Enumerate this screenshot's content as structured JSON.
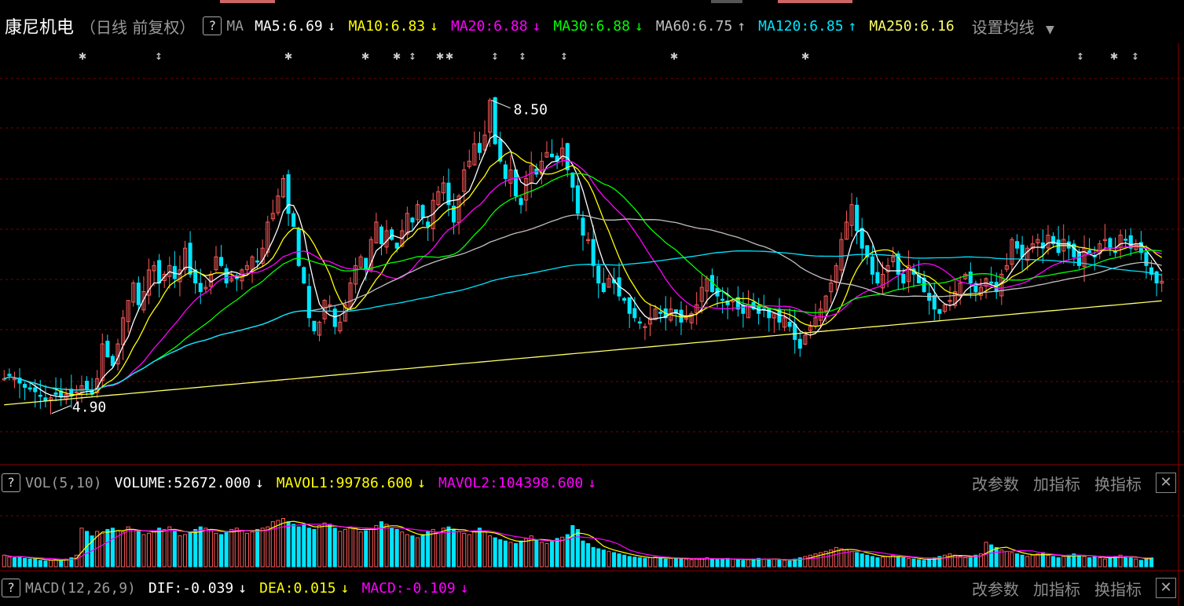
{
  "header": {
    "help_icon": "?",
    "stock_name": "康尼机电",
    "period": "（日线 前复权）",
    "ma_label": "MA",
    "indicators": [
      {
        "label": "MA5:6.69",
        "arrow": "↓",
        "color": "#ffffff"
      },
      {
        "label": "MA10:6.83",
        "arrow": "↓",
        "color": "#ffff00"
      },
      {
        "label": "MA20:6.88",
        "arrow": "↓",
        "color": "#ff00ff"
      },
      {
        "label": "MA30:6.88",
        "arrow": "↓",
        "color": "#00ff00"
      },
      {
        "label": "MA60:6.75",
        "arrow": "↑",
        "color": "#c0c0c0"
      },
      {
        "label": "MA120:6.85",
        "arrow": "↑",
        "color": "#00e5ff"
      },
      {
        "label": "MA250:6.16",
        "arrow": "",
        "color": "#ffff66"
      }
    ],
    "settings_label": "设置均线",
    "settings_icon": "chevron-down-icon"
  },
  "annotations": {
    "high": "8.50",
    "low": "4.90"
  },
  "vol_panel": {
    "help_icon": "?",
    "name": "VOL(5,10)",
    "items": [
      {
        "label": "VOLUME:52672.000",
        "arrow": "↓",
        "color": "#ffffff"
      },
      {
        "label": "MAVOL1:99786.600",
        "arrow": "↓",
        "color": "#ffff00"
      },
      {
        "label": "MAVOL2:104398.600",
        "arrow": "↓",
        "color": "#ff00ff"
      }
    ],
    "tools": [
      "改参数",
      "加指标",
      "换指标"
    ],
    "close": "✕"
  },
  "macd_panel": {
    "help_icon": "?",
    "name": "MACD(12,26,9)",
    "items": [
      {
        "label": "DIF:-0.039",
        "arrow": "↓",
        "color": "#ffffff"
      },
      {
        "label": "DEA:0.015",
        "arrow": "↓",
        "color": "#ffff00"
      },
      {
        "label": "MACD:-0.109",
        "arrow": "↓",
        "color": "#ff00ff"
      }
    ],
    "tools": [
      "改参数",
      "加指标",
      "换指标"
    ],
    "close": "✕"
  },
  "colors": {
    "up": "#ff5a5a",
    "down": "#00e5ff",
    "grid": "#7a0000"
  },
  "chart_data": {
    "type": "candlestick",
    "ylim": [
      4.6,
      8.75
    ],
    "high": 8.5,
    "low": 4.9,
    "marker_count": 18,
    "close_prices": [
      5.3,
      5.34,
      5.3,
      5.25,
      5.2,
      5.18,
      5.15,
      5.1,
      5.05,
      5.08,
      5.12,
      5.1,
      5.12,
      5.1,
      5.15,
      5.22,
      5.18,
      5.12,
      5.3,
      5.7,
      5.55,
      5.45,
      5.7,
      6.0,
      6.2,
      6.4,
      6.15,
      6.3,
      6.55,
      6.6,
      6.4,
      6.5,
      6.6,
      6.45,
      6.55,
      6.8,
      6.5,
      6.4,
      6.3,
      6.35,
      6.5,
      6.7,
      6.6,
      6.4,
      6.45,
      6.45,
      6.55,
      6.6,
      6.7,
      6.65,
      6.8,
      7.1,
      7.2,
      7.4,
      7.6,
      7.2,
      7.05,
      6.6,
      6.4,
      6.0,
      5.85,
      5.95,
      6.2,
      6.15,
      5.9,
      5.95,
      6.15,
      6.4,
      6.6,
      6.7,
      6.55,
      6.9,
      7.1,
      6.85,
      7.0,
      6.9,
      6.8,
      7.0,
      7.2,
      7.1,
      7.3,
      7.15,
      7.05,
      7.35,
      7.45,
      7.55,
      7.3,
      7.1,
      7.4,
      7.7,
      7.8,
      8.0,
      7.9,
      8.1,
      8.5,
      8.0,
      7.8,
      7.6,
      7.7,
      7.4,
      7.3,
      7.6,
      7.75,
      7.65,
      7.8,
      7.9,
      7.85,
      7.8,
      7.95,
      7.7,
      7.5,
      7.2,
      6.95,
      6.9,
      6.6,
      6.4,
      6.3,
      6.45,
      6.4,
      6.25,
      6.2,
      6.05,
      6.0,
      5.95,
      5.9,
      6.0,
      6.1,
      6.05,
      6.0,
      6.1,
      6.05,
      5.95,
      6.0,
      6.05,
      6.15,
      6.35,
      6.45,
      6.3,
      6.25,
      6.2,
      6.15,
      6.2,
      6.1,
      6.05,
      6.15,
      6.1,
      6.05,
      6.1,
      6.0,
      6.05,
      5.95,
      6.0,
      5.9,
      5.75,
      5.65,
      5.8,
      5.9,
      6.0,
      6.1,
      6.25,
      6.4,
      6.6,
      6.9,
      7.1,
      7.3,
      7.0,
      6.8,
      6.7,
      6.5,
      6.4,
      6.5,
      6.6,
      6.7,
      6.5,
      6.4,
      6.6,
      6.5,
      6.4,
      6.3,
      6.2,
      6.1,
      6.05,
      6.15,
      6.2,
      6.3,
      6.4,
      6.5,
      6.4,
      6.3,
      6.35,
      6.45,
      6.4,
      6.3,
      6.5,
      6.6,
      6.9,
      6.8,
      6.7,
      6.8,
      6.85,
      6.9,
      6.8,
      6.95,
      6.85,
      6.75,
      6.9,
      6.8,
      6.7,
      6.6,
      6.8,
      6.75,
      6.7,
      6.85,
      6.9,
      6.8,
      6.75,
      6.95,
      6.9,
      6.8,
      6.85,
      6.75,
      6.6,
      6.5,
      6.4,
      6.42
    ],
    "volumes": [
      18,
      15,
      14,
      16,
      13,
      12,
      12,
      10,
      9,
      10,
      11,
      10,
      12,
      14,
      18,
      60,
      55,
      48,
      55,
      52,
      58,
      60,
      56,
      54,
      62,
      58,
      55,
      50,
      52,
      56,
      60,
      58,
      62,
      55,
      48,
      50,
      54,
      58,
      62,
      60,
      56,
      52,
      50,
      55,
      58,
      60,
      56,
      52,
      54,
      58,
      60,
      62,
      70,
      72,
      75,
      70,
      66,
      62,
      65,
      60,
      58,
      64,
      68,
      66,
      60,
      55,
      58,
      62,
      60,
      54,
      56,
      58,
      64,
      70,
      66,
      60,
      58,
      54,
      50,
      48,
      45,
      50,
      55,
      58,
      54,
      60,
      62,
      58,
      55,
      52,
      50,
      55,
      60,
      54,
      48,
      45,
      42,
      40,
      38,
      36,
      40,
      44,
      48,
      42,
      38,
      36,
      40,
      44,
      46,
      50,
      64,
      58,
      40,
      36,
      30,
      28,
      26,
      24,
      22,
      20,
      18,
      16,
      15,
      14,
      13,
      14,
      15,
      14,
      12,
      13,
      14,
      13,
      12,
      11,
      12,
      13,
      14,
      12,
      11,
      12,
      13,
      12,
      11,
      10,
      11,
      12,
      13,
      12,
      11,
      12,
      11,
      10,
      9,
      12,
      14,
      16,
      18,
      20,
      22,
      24,
      26,
      30,
      28,
      26,
      24,
      22,
      20,
      18,
      16,
      14,
      15,
      16,
      18,
      16,
      14,
      13,
      12,
      11,
      10,
      12,
      14,
      16,
      18,
      20,
      18,
      16,
      14,
      15,
      18,
      20,
      38,
      34,
      30,
      26,
      24,
      22,
      20,
      18,
      16,
      18,
      20,
      22,
      18,
      16,
      14,
      16,
      18,
      20,
      18,
      16,
      14,
      16,
      14,
      12,
      14,
      16,
      18,
      16,
      14,
      12,
      10,
      12,
      14
    ],
    "ma_lines": [
      "MA5",
      "MA10",
      "MA20",
      "MA30",
      "MA60",
      "MA120",
      "MA250"
    ]
  }
}
